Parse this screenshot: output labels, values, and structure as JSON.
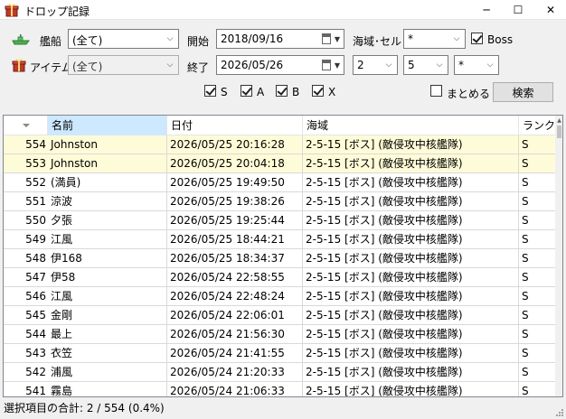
{
  "window": {
    "title": "ドロップ記録",
    "minimize_glyph": "─",
    "maximize_glyph": "☐",
    "close_glyph": "✕",
    "icon": "gift-box-icon"
  },
  "filters": {
    "ship_label": "艦船",
    "ship_value": "(全て)",
    "ship_icon": "ship-icon",
    "item_label": "アイテム",
    "item_value": "(全て)",
    "item_icon": "gift-box-icon",
    "start_label": "開始",
    "start_date": "2018/09/16",
    "end_label": "終了",
    "end_date": "2026/05/26",
    "area_label": "海域･セル",
    "world_value": "*",
    "map_value": "2",
    "area_value": "5",
    "cell_value": "*",
    "boss_label": "Boss",
    "boss_checked": true,
    "rank_s_label": "S",
    "rank_a_label": "A",
    "rank_b_label": "B",
    "rank_x_label": "X",
    "merge_label": "まとめる",
    "merge_checked": false,
    "search_button": "検索"
  },
  "grid": {
    "columns": [
      "",
      "名前",
      "日付",
      "海域",
      "ランク"
    ],
    "rows": [
      {
        "no": "554",
        "name": "Johnston",
        "date": "2026/05/25 20:16:28",
        "area": "2-5-15 [ボス] (敵侵攻中核艦隊)",
        "rank": "S",
        "selected": true
      },
      {
        "no": "553",
        "name": "Johnston",
        "date": "2026/05/25 20:04:18",
        "area": "2-5-15 [ボス] (敵侵攻中核艦隊)",
        "rank": "S",
        "selected": true
      },
      {
        "no": "552",
        "name": "(満員)",
        "date": "2026/05/25 19:49:50",
        "area": "2-5-15 [ボス] (敵侵攻中核艦隊)",
        "rank": "S",
        "selected": false
      },
      {
        "no": "551",
        "name": "涼波",
        "date": "2026/05/25 19:38:26",
        "area": "2-5-15 [ボス] (敵侵攻中核艦隊)",
        "rank": "S",
        "selected": false
      },
      {
        "no": "550",
        "name": "夕張",
        "date": "2026/05/25 19:25:44",
        "area": "2-5-15 [ボス] (敵侵攻中核艦隊)",
        "rank": "S",
        "selected": false
      },
      {
        "no": "549",
        "name": "江風",
        "date": "2026/05/25 18:44:21",
        "area": "2-5-15 [ボス] (敵侵攻中核艦隊)",
        "rank": "S",
        "selected": false
      },
      {
        "no": "548",
        "name": "伊168",
        "date": "2026/05/25 18:34:37",
        "area": "2-5-15 [ボス] (敵侵攻中核艦隊)",
        "rank": "S",
        "selected": false
      },
      {
        "no": "547",
        "name": "伊58",
        "date": "2026/05/24 22:58:55",
        "area": "2-5-15 [ボス] (敵侵攻中核艦隊)",
        "rank": "S",
        "selected": false
      },
      {
        "no": "546",
        "name": "江風",
        "date": "2026/05/24 22:48:24",
        "area": "2-5-15 [ボス] (敵侵攻中核艦隊)",
        "rank": "S",
        "selected": false
      },
      {
        "no": "545",
        "name": "金剛",
        "date": "2026/05/24 22:06:01",
        "area": "2-5-15 [ボス] (敵侵攻中核艦隊)",
        "rank": "S",
        "selected": false
      },
      {
        "no": "544",
        "name": "最上",
        "date": "2026/05/24 21:56:30",
        "area": "2-5-15 [ボス] (敵侵攻中核艦隊)",
        "rank": "S",
        "selected": false
      },
      {
        "no": "543",
        "name": "衣笠",
        "date": "2026/05/24 21:41:55",
        "area": "2-5-15 [ボス] (敵侵攻中核艦隊)",
        "rank": "S",
        "selected": false
      },
      {
        "no": "542",
        "name": "浦風",
        "date": "2026/05/24 21:20:33",
        "area": "2-5-15 [ボス] (敵侵攻中核艦隊)",
        "rank": "S",
        "selected": false
      },
      {
        "no": "541",
        "name": "霧島",
        "date": "2026/05/24 21:06:33",
        "area": "2-5-15 [ボス] (敵侵攻中核艦隊)",
        "rank": "S",
        "selected": false
      }
    ]
  },
  "status": {
    "text": "選択項目の合計: 2 / 554 (0.4%)"
  },
  "colors": {
    "selected_row": "#fefcd8",
    "sorted_header": "#cde8ff",
    "border": "#828790"
  }
}
